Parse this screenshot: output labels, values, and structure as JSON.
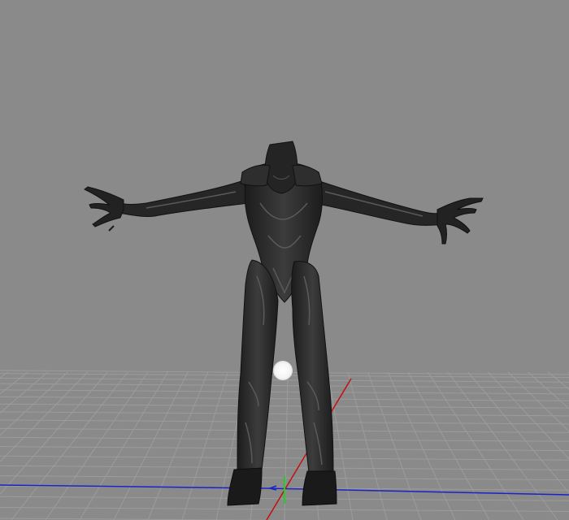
{
  "viewport": {
    "kind": "3d-model-viewer",
    "background_color": "#8a8a8a",
    "grid_color": "#9c9c9c",
    "grid_visible": true
  },
  "axes": {
    "x_axis_color": "#c01010",
    "z_axis_color": "#1a22c8",
    "y_axis_color": "#20d020"
  },
  "model": {
    "pose": "T-pose",
    "color": "#2a2a2a",
    "highlight_color": "#5a5a5a"
  },
  "light": {
    "color": "#ffffff",
    "icon": "light-source-icon"
  }
}
